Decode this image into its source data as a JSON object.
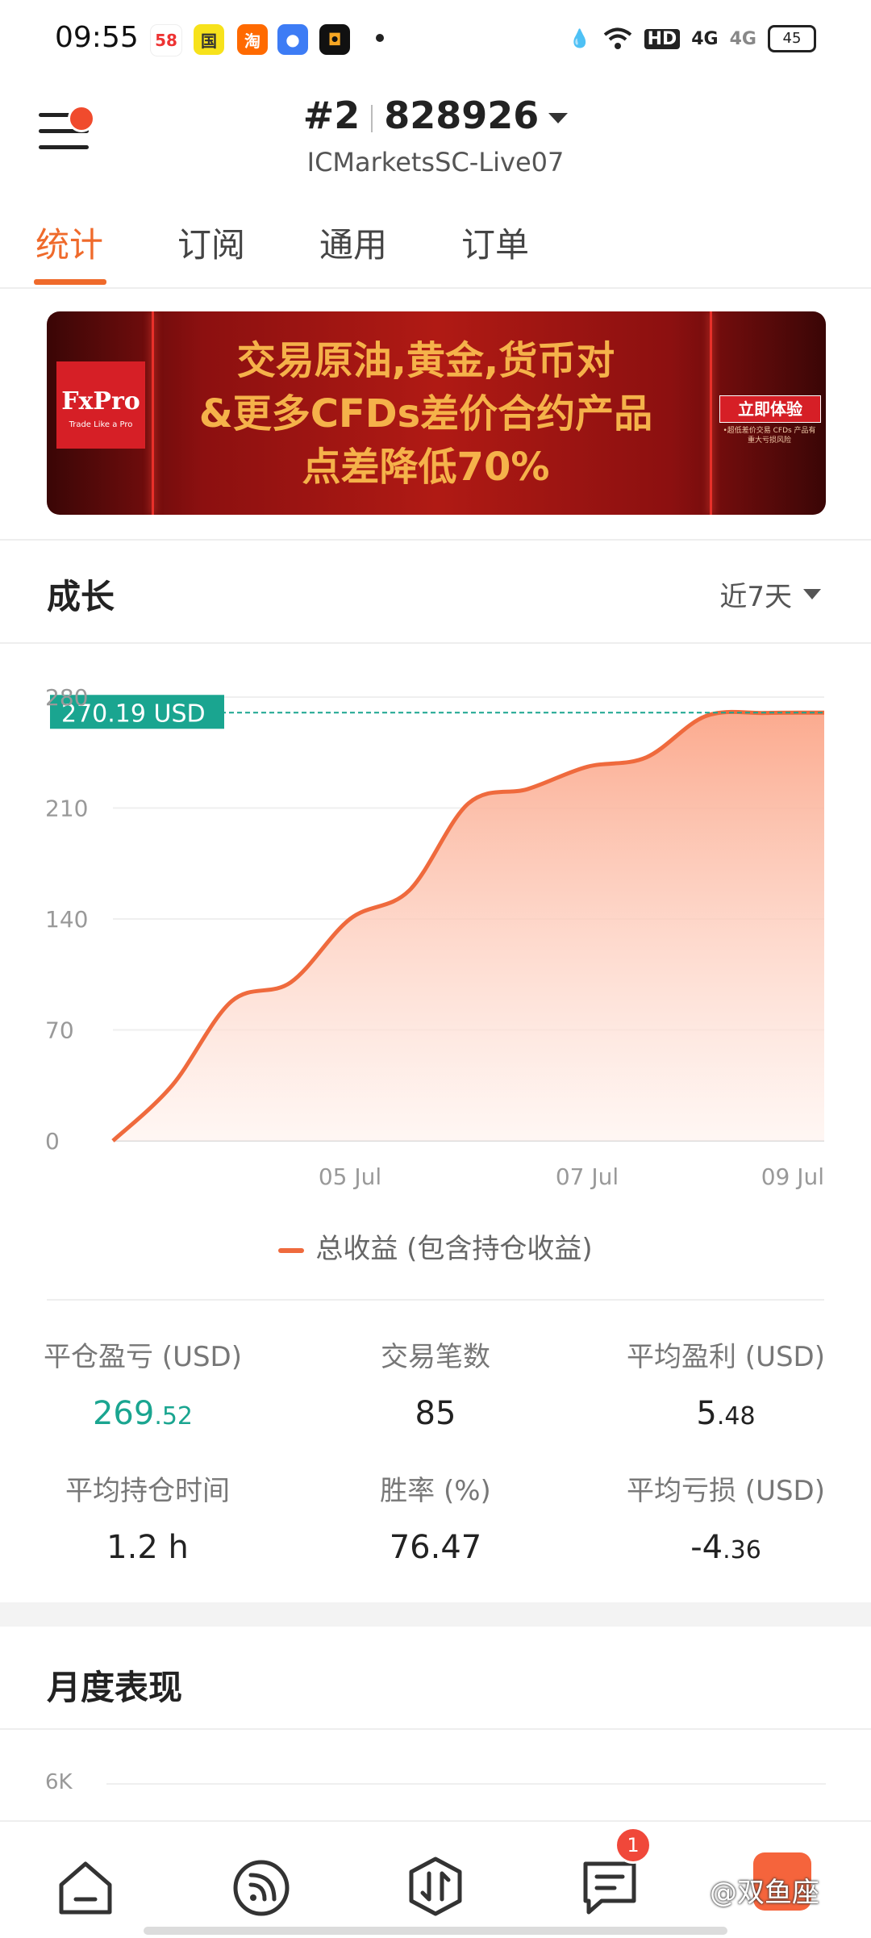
{
  "status_bar": {
    "time": "09:55",
    "notification_icons": [
      "58-app-icon",
      "news-app-icon",
      "taobao-icon",
      "chat-app-icon",
      "camera-app-icon"
    ],
    "system_icons": [
      "water-drop-icon",
      "wifi-icon",
      "hd-icon",
      "signal-4g-icon",
      "signal-4g-icon"
    ],
    "hd_label": "HD",
    "net1": "4G",
    "net2": "4G",
    "battery": "45"
  },
  "header": {
    "account_index": "#2",
    "account_number": "828926",
    "server": "ICMarketsSC-Live07"
  },
  "tabs": [
    {
      "label": "统计",
      "active": true
    },
    {
      "label": "订阅",
      "active": false
    },
    {
      "label": "通用",
      "active": false
    },
    {
      "label": "订单",
      "active": false
    }
  ],
  "banner": {
    "logo_brand": "FxPro",
    "logo_tagline": "Trade Like a Pro",
    "line1": "交易原油,黄金,货币对",
    "line2": "&更多CFDs差价合约产品",
    "line3": "点差降低70%",
    "cta": "立即体验",
    "cta_sub": "•超低差价交易 CFDs 产品有重大亏损风险"
  },
  "growth": {
    "title": "成长",
    "period": "近7天"
  },
  "chart_data": {
    "type": "area",
    "series": [
      {
        "name": "总收益 (包含持仓收益)",
        "x": [
          "03 Jul",
          "03.5 Jul",
          "04 Jul",
          "04.5 Jul",
          "05 Jul",
          "05.5 Jul",
          "06 Jul",
          "06.5 Jul",
          "07 Jul",
          "07.5 Jul",
          "08 Jul",
          "08.5 Jul",
          "09 Jul"
        ],
        "values": [
          0,
          35,
          88,
          100,
          140,
          158,
          213,
          222,
          236,
          242,
          268,
          270,
          270.19
        ]
      }
    ],
    "x_ticks": [
      "05 Jul",
      "07 Jul",
      "09 Jul"
    ],
    "y_ticks": [
      0,
      70,
      140,
      210,
      280
    ],
    "ylim": [
      0,
      280
    ],
    "current_value_label": "270.19 USD",
    "line_color": "#ef6a3d",
    "fill_color": "#fbb9a0",
    "marker_color": "#1aa590"
  },
  "stats": [
    {
      "label": "平仓盈亏 (USD)",
      "value_int": "269",
      "value_dec": ".52",
      "color": "green"
    },
    {
      "label": "交易笔数",
      "value_int": "85",
      "value_dec": ""
    },
    {
      "label": "平均盈利 (USD)",
      "value_int": "5",
      "value_dec": ".48"
    },
    {
      "label": "平均持仓时间",
      "value_int": "1.2 h",
      "value_dec": ""
    },
    {
      "label": "胜率 (%)",
      "value_int": "76.47",
      "value_dec": ""
    },
    {
      "label": "平均亏损 (USD)",
      "value_int": "-4",
      "value_dec": ".36"
    }
  ],
  "monthly": {
    "title": "月度表现",
    "y_tick": "6K"
  },
  "bottom_nav": {
    "items": [
      "home-icon",
      "feed-icon",
      "trade-icon",
      "messages-icon",
      "promo-icon"
    ],
    "badge": "1",
    "watermark": "@双鱼座"
  }
}
